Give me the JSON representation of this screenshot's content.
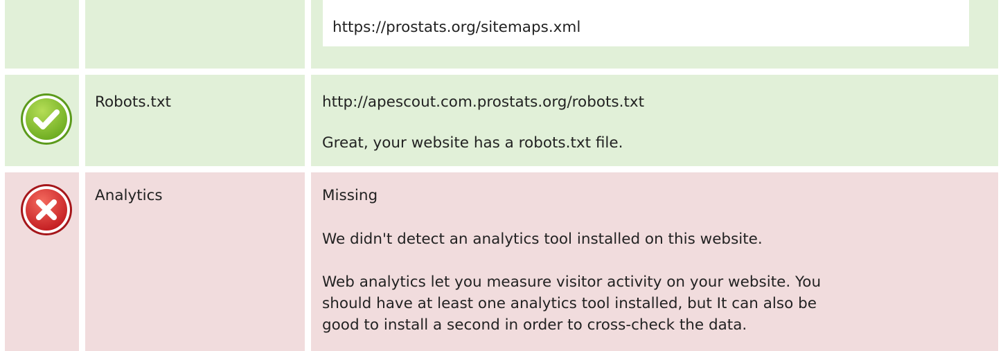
{
  "sitemaps": {
    "url": "https://prostats.org/sitemaps.xml",
    "status": "pass",
    "icon": "check-icon"
  },
  "robots": {
    "label": "Robots.txt",
    "status": "pass",
    "icon": "check-icon",
    "url": "http://apescout.com.prostats.org/robots.txt",
    "message": "Great, your website has a robots.txt file."
  },
  "analytics": {
    "label": "Analytics",
    "status": "fail",
    "icon": "cross-icon",
    "value": "Missing",
    "message": "We didn't detect an analytics tool installed on this website.",
    "advice_line1": "Web analytics let you measure visitor activity on your website. You",
    "advice_line2": "should have at least one analytics tool installed, but It can also be",
    "advice_line3": "good to install a second in order to cross-check the data."
  },
  "colors": {
    "pass_bg": "#e1f0d8",
    "fail_bg": "#f1dcdd",
    "pass_icon": "#7dbb2a",
    "fail_icon": "#d9282c"
  }
}
